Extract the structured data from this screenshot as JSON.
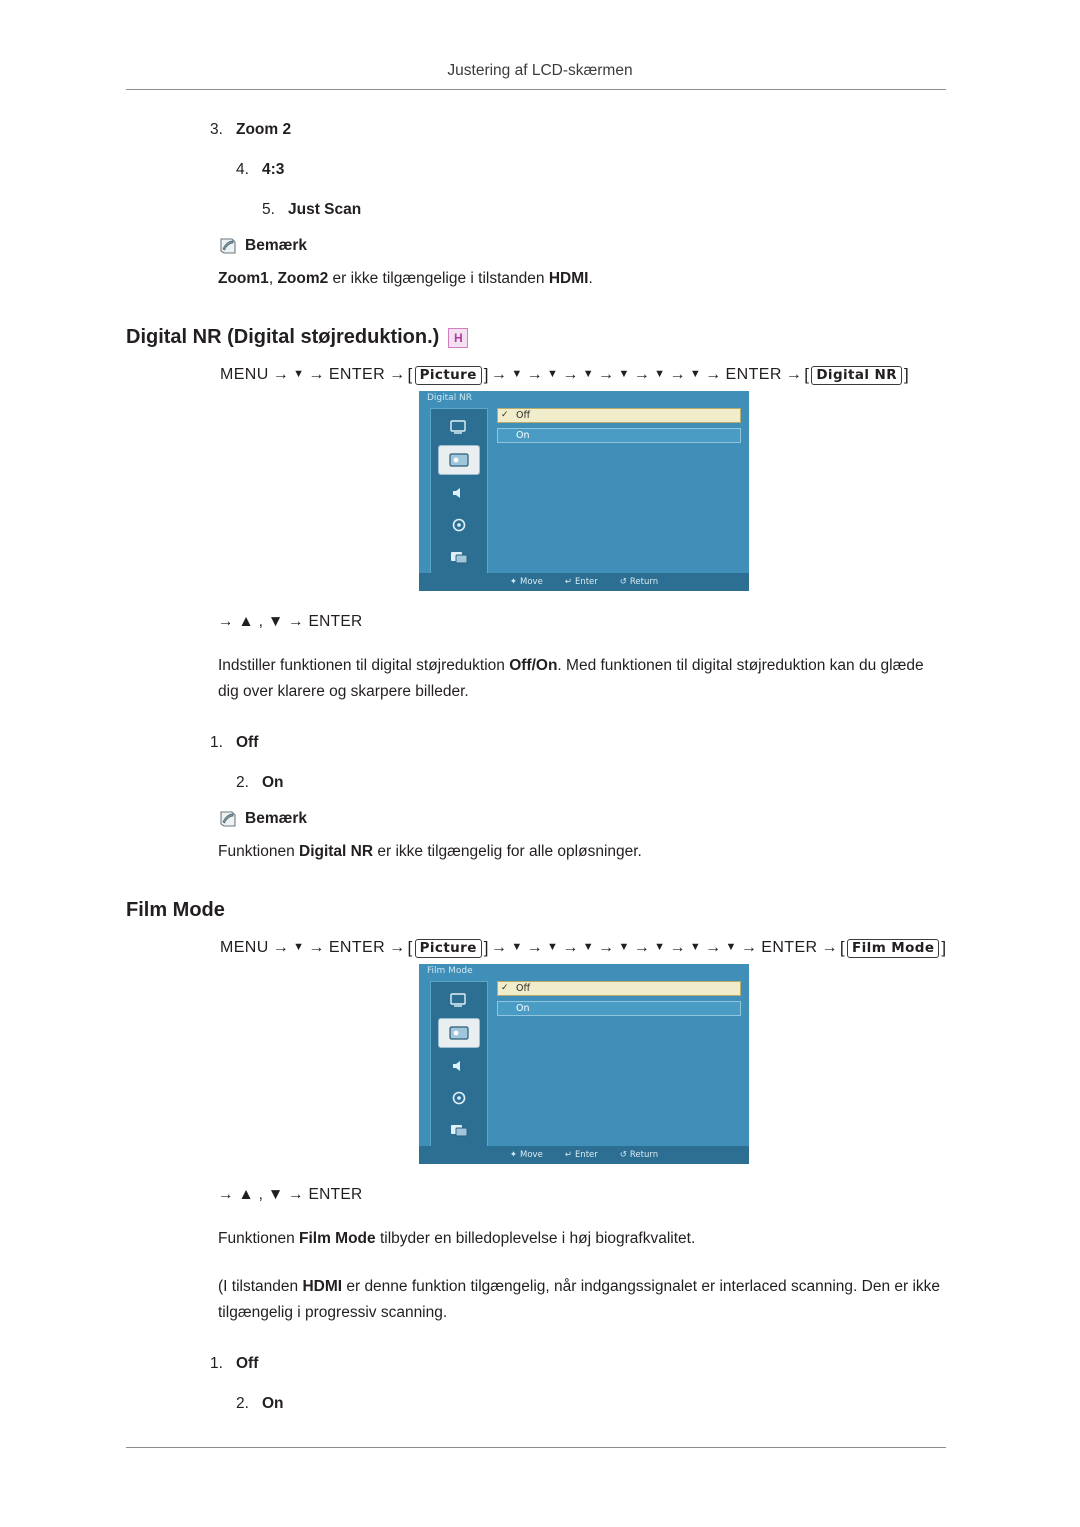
{
  "header": {
    "title": "Justering af LCD-skærmen"
  },
  "top_list": [
    {
      "num": "3.",
      "label": "Zoom 2",
      "indent": 1
    },
    {
      "num": "4.",
      "label": "4:3",
      "indent": 2
    },
    {
      "num": "5.",
      "label": "Just Scan",
      "indent": 3
    }
  ],
  "note1": {
    "label": "Bemærk",
    "text_before": "",
    "text": "Zoom1, Zoom2 er ikke tilgængelige i tilstanden HDMI.",
    "bold_parts": [
      "Zoom1",
      "Zoom2",
      "HDMI"
    ]
  },
  "section_digital_nr": {
    "title": "Digital NR (Digital støjreduktion.)",
    "badge": "H",
    "menupath": {
      "start": "MENU",
      "arrow": "→",
      "down": "▼",
      "enter": "ENTER",
      "key_picture": "Picture",
      "key_target": "Digital NR",
      "down_count": 6
    },
    "osd": {
      "title": "Digital NR",
      "rows": [
        {
          "label": "Off",
          "state": "highlighted",
          "check": "✓"
        },
        {
          "label": "On",
          "state": "normal",
          "check": ""
        }
      ],
      "bottom": [
        {
          "icon": "✦",
          "label": "Move"
        },
        {
          "icon": "↵",
          "label": "Enter"
        },
        {
          "icon": "↺",
          "label": "Return"
        }
      ],
      "side_icons": [
        "input-icon",
        "picture-icon",
        "sound-icon",
        "setup-icon",
        "multi-control-icon"
      ]
    },
    "keyline": "→ ▲ , ▼ → ENTER",
    "paragraph": "Indstiller funktionen til digital støjreduktion Off/On. Med funktionen til digital støjreduktion kan du glæde dig over klarere og skarpere billeder.",
    "options": [
      {
        "num": "1.",
        "label": "Off"
      },
      {
        "num": "2.",
        "label": "On"
      }
    ],
    "note": {
      "label": "Bemærk",
      "text": "Funktionen Digital NR er ikke tilgængelig for alle opløsninger."
    }
  },
  "section_film_mode": {
    "title": "Film Mode",
    "menupath": {
      "start": "MENU",
      "arrow": "→",
      "down": "▼",
      "enter": "ENTER",
      "key_picture": "Picture",
      "key_target": "Film Mode",
      "down_count": 7
    },
    "osd": {
      "title": "Film Mode",
      "rows": [
        {
          "label": "Off",
          "state": "highlighted",
          "check": "✓"
        },
        {
          "label": "On",
          "state": "normal",
          "check": ""
        }
      ],
      "bottom": [
        {
          "icon": "✦",
          "label": "Move"
        },
        {
          "icon": "↵",
          "label": "Enter"
        },
        {
          "icon": "↺",
          "label": "Return"
        }
      ]
    },
    "keyline": "→ ▲ , ▼ → ENTER",
    "paragraph1": "Funktionen Film Mode tilbyder en billedoplevelse i høj biografkvalitet.",
    "paragraph2": "(I tilstanden HDMI er denne funktion tilgængelig, når indgangssignalet er interlaced scanning. Den er ikke tilgængelig i progressiv scanning.",
    "options": [
      {
        "num": "1.",
        "label": "Off"
      },
      {
        "num": "2.",
        "label": "On"
      }
    ]
  },
  "colors": {
    "osd_bg": "#3f8fb8",
    "osd_panel": "#2d6f93",
    "osd_highlight": "#f1ecc9",
    "badge_pink": "#b03ba0"
  }
}
